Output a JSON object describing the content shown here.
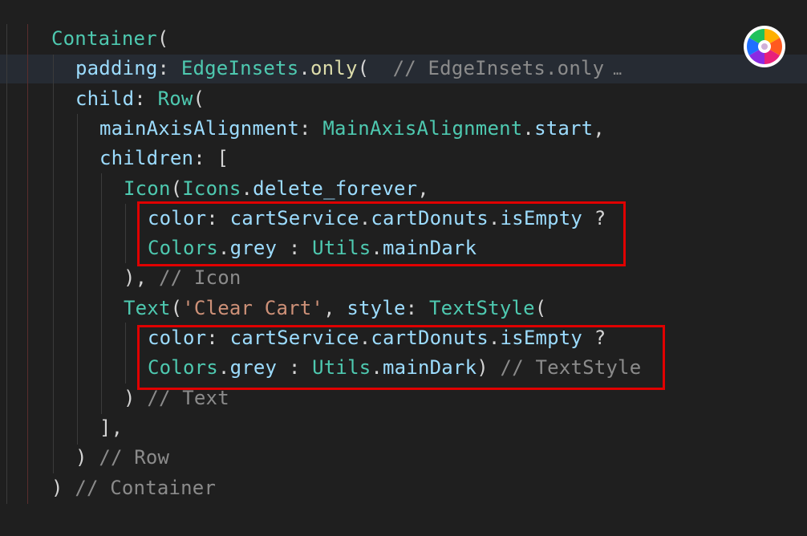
{
  "editor": {
    "lines": [
      {
        "tokens": [
          {
            "t": "Container",
            "c": "cls"
          },
          {
            "t": "(",
            "c": "punc"
          }
        ]
      },
      {
        "tokens": [
          {
            "t": "padding",
            "c": "prop"
          },
          {
            "t": ": ",
            "c": "punc"
          },
          {
            "t": "EdgeInsets",
            "c": "cls"
          },
          {
            "t": ".",
            "c": "punc"
          },
          {
            "t": "only",
            "c": "fn"
          },
          {
            "t": "(  ",
            "c": "punc"
          },
          {
            "t": "// EdgeInsets.only",
            "c": "cmt"
          },
          {
            "t": " …",
            "c": "ell"
          }
        ]
      },
      {
        "tokens": [
          {
            "t": "child",
            "c": "prop"
          },
          {
            "t": ": ",
            "c": "punc"
          },
          {
            "t": "Row",
            "c": "cls"
          },
          {
            "t": "(",
            "c": "punc"
          }
        ]
      },
      {
        "tokens": [
          {
            "t": "mainAxisAlignment",
            "c": "prop"
          },
          {
            "t": ": ",
            "c": "punc"
          },
          {
            "t": "MainAxisAlignment",
            "c": "cls"
          },
          {
            "t": ".",
            "c": "punc"
          },
          {
            "t": "start",
            "c": "prop"
          },
          {
            "t": ",",
            "c": "punc"
          }
        ]
      },
      {
        "tokens": [
          {
            "t": "children",
            "c": "prop"
          },
          {
            "t": ": [",
            "c": "punc"
          }
        ]
      },
      {
        "tokens": [
          {
            "t": "Icon",
            "c": "cls"
          },
          {
            "t": "(",
            "c": "punc"
          },
          {
            "t": "Icons",
            "c": "cls"
          },
          {
            "t": ".",
            "c": "punc"
          },
          {
            "t": "delete_forever",
            "c": "prop"
          },
          {
            "t": ",",
            "c": "punc"
          }
        ]
      },
      {
        "tokens": [
          {
            "t": "color",
            "c": "prop"
          },
          {
            "t": ": ",
            "c": "punc"
          },
          {
            "t": "cartService",
            "c": "prop"
          },
          {
            "t": ".",
            "c": "punc"
          },
          {
            "t": "cartDonuts",
            "c": "prop"
          },
          {
            "t": ".",
            "c": "punc"
          },
          {
            "t": "isEmpty",
            "c": "prop"
          },
          {
            "t": " ?",
            "c": "punc"
          }
        ]
      },
      {
        "tokens": [
          {
            "t": "Colors",
            "c": "cls"
          },
          {
            "t": ".",
            "c": "punc"
          },
          {
            "t": "grey",
            "c": "prop"
          },
          {
            "t": " : ",
            "c": "punc"
          },
          {
            "t": "Utils",
            "c": "cls"
          },
          {
            "t": ".",
            "c": "punc"
          },
          {
            "t": "mainDark",
            "c": "prop"
          }
        ]
      },
      {
        "tokens": [
          {
            "t": "), ",
            "c": "punc"
          },
          {
            "t": "// Icon",
            "c": "cmt"
          }
        ]
      },
      {
        "tokens": [
          {
            "t": "Text",
            "c": "cls"
          },
          {
            "t": "(",
            "c": "punc"
          },
          {
            "t": "'Clear Cart'",
            "c": "str"
          },
          {
            "t": ", ",
            "c": "punc"
          },
          {
            "t": "style",
            "c": "prop"
          },
          {
            "t": ": ",
            "c": "punc"
          },
          {
            "t": "TextStyle",
            "c": "cls"
          },
          {
            "t": "(",
            "c": "punc"
          }
        ]
      },
      {
        "tokens": [
          {
            "t": "color",
            "c": "prop"
          },
          {
            "t": ": ",
            "c": "punc"
          },
          {
            "t": "cartService",
            "c": "prop"
          },
          {
            "t": ".",
            "c": "punc"
          },
          {
            "t": "cartDonuts",
            "c": "prop"
          },
          {
            "t": ".",
            "c": "punc"
          },
          {
            "t": "isEmpty",
            "c": "prop"
          },
          {
            "t": " ?",
            "c": "punc"
          }
        ]
      },
      {
        "tokens": [
          {
            "t": "Colors",
            "c": "cls"
          },
          {
            "t": ".",
            "c": "punc"
          },
          {
            "t": "grey",
            "c": "prop"
          },
          {
            "t": " : ",
            "c": "punc"
          },
          {
            "t": "Utils",
            "c": "cls"
          },
          {
            "t": ".",
            "c": "punc"
          },
          {
            "t": "mainDark",
            "c": "prop"
          },
          {
            "t": ") ",
            "c": "punc"
          },
          {
            "t": "// TextStyle",
            "c": "cmt"
          }
        ]
      },
      {
        "tokens": [
          {
            "t": ") ",
            "c": "punc"
          },
          {
            "t": "// Text",
            "c": "cmt"
          }
        ]
      },
      {
        "tokens": [
          {
            "t": "],",
            "c": "punc"
          }
        ]
      },
      {
        "tokens": [
          {
            "t": ") ",
            "c": "punc"
          },
          {
            "t": "// Row",
            "c": "cmt"
          }
        ]
      },
      {
        "tokens": [
          {
            "t": ") ",
            "c": "punc"
          },
          {
            "t": "// Container",
            "c": "cmt"
          }
        ]
      }
    ]
  },
  "colors": {
    "background": "#1f1f1f",
    "highlight_box": "#e00000",
    "class": "#4ec9b0",
    "property": "#9cdcfe",
    "function": "#dcdcaa",
    "comment": "#8b8b8b",
    "string": "#ce9178"
  },
  "icons": {
    "app": "color-wheel-icon"
  }
}
